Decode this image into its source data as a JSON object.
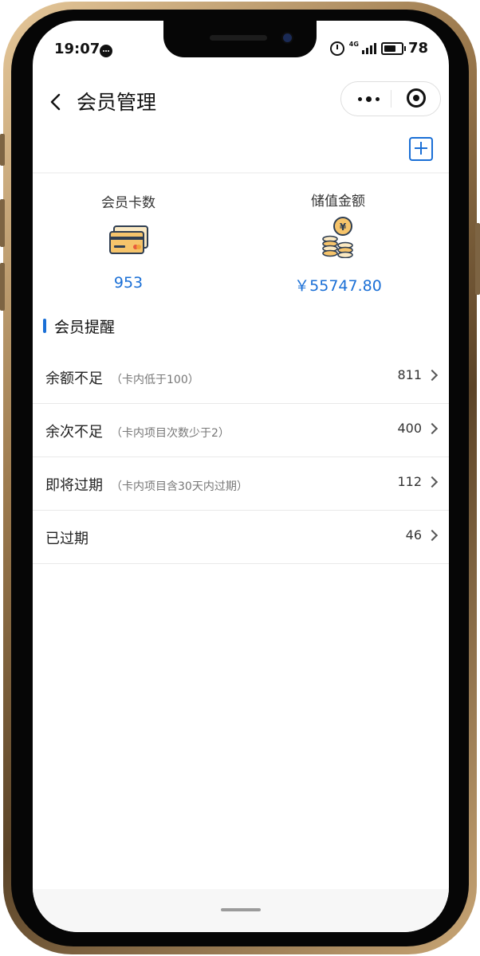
{
  "status": {
    "time": "19:07",
    "network": "4G",
    "battery": "78"
  },
  "nav": {
    "title": "会员管理"
  },
  "stats": {
    "cards_label": "会员卡数",
    "cards_value": "953",
    "balance_label": "储值金额",
    "balance_value": "￥55747.80"
  },
  "reminder": {
    "title": "会员提醒",
    "items": [
      {
        "title": "余额不足",
        "subtitle": "（卡内低于100）",
        "count": "811"
      },
      {
        "title": "余次不足",
        "subtitle": "（卡内项目次数少于2）",
        "count": "400"
      },
      {
        "title": "即将过期",
        "subtitle": "（卡内项目含30天内过期）",
        "count": "112"
      },
      {
        "title": "已过期",
        "subtitle": "",
        "count": "46"
      }
    ]
  },
  "colors": {
    "accent": "#1a6fd6",
    "frame_gold": "#b8945e",
    "divider": "#e9e9e9"
  },
  "icons": [
    "message-icon",
    "alarm-icon",
    "signal-icon",
    "battery-icon",
    "back-icon",
    "more-icon",
    "target-icon",
    "add-icon",
    "card-icon",
    "coin-stack-icon",
    "chevron-right-icon"
  ]
}
